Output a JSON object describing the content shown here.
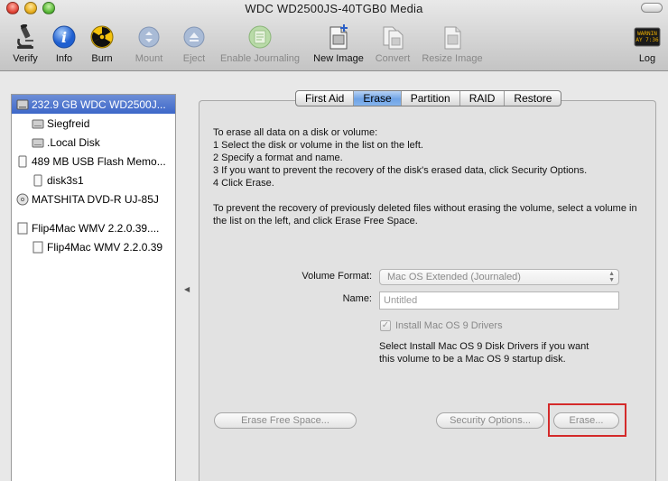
{
  "window": {
    "title": "WDC WD2500JS-40TGB0 Media"
  },
  "toolbar": {
    "items": [
      {
        "label": "Verify",
        "icon": "microscope-icon",
        "enabled": true
      },
      {
        "label": "Info",
        "icon": "info-icon",
        "enabled": true
      },
      {
        "label": "Burn",
        "icon": "radiation-icon",
        "enabled": true
      },
      {
        "label": "Mount",
        "icon": "mount-icon",
        "enabled": false
      },
      {
        "label": "Eject",
        "icon": "eject-icon",
        "enabled": false
      },
      {
        "label": "Enable Journaling",
        "icon": "journaling-icon",
        "enabled": false
      },
      {
        "label": "New Image",
        "icon": "new-image-icon",
        "enabled": true
      },
      {
        "label": "Convert",
        "icon": "convert-icon",
        "enabled": false
      },
      {
        "label": "Resize Image",
        "icon": "resize-image-icon",
        "enabled": false
      },
      {
        "label": "Log",
        "icon": "log-icon",
        "enabled": true
      }
    ],
    "log_icon_text": [
      "WARNIN",
      "AY 7:36"
    ]
  },
  "sidebar": {
    "items": [
      {
        "label": "232.9 GB WDC WD2500J...",
        "level": 0,
        "kind": "hdd",
        "selected": true
      },
      {
        "label": "Siegfreid",
        "level": 1,
        "kind": "volume"
      },
      {
        "label": ".Local Disk",
        "level": 1,
        "kind": "volume"
      },
      {
        "label": "489 MB USB Flash Memo...",
        "level": 0,
        "kind": "usb"
      },
      {
        "label": "disk3s1",
        "level": 1,
        "kind": "usb"
      },
      {
        "label": "MATSHITA DVD-R UJ-85J",
        "level": 0,
        "kind": "dvd"
      },
      {
        "label": "Flip4Mac WMV 2.2.0.39....",
        "level": 0,
        "kind": "image",
        "gap_before": true
      },
      {
        "label": "Flip4Mac WMV 2.2.0.39",
        "level": 1,
        "kind": "image"
      }
    ]
  },
  "tabs": [
    {
      "label": "First Aid",
      "active": false
    },
    {
      "label": "Erase",
      "active": true
    },
    {
      "label": "Partition",
      "active": false
    },
    {
      "label": "RAID",
      "active": false
    },
    {
      "label": "Restore",
      "active": false
    }
  ],
  "erase": {
    "instructions": [
      "To erase all data on a disk or volume:",
      "1 Select the disk or volume in the list on the left.",
      "2 Specify a format and name.",
      "3 If you want to prevent the recovery of the disk's erased data, click Security Options.",
      "4 Click Erase."
    ],
    "free_space_instructions": "To prevent the recovery of previously deleted files without erasing the volume, select a volume in the list on the left, and click Erase Free Space.",
    "volume_format_label": "Volume Format:",
    "volume_format_value": "Mac OS Extended (Journaled)",
    "name_label": "Name:",
    "name_value": "Untitled",
    "os9_checkbox_label": "Install Mac OS 9 Drivers",
    "os9_note": "Select Install Mac OS 9 Disk Drivers if you want this volume to be a Mac OS 9 startup disk.",
    "erase_free_space_button": "Erase Free Space...",
    "security_options_button": "Security Options...",
    "erase_button": "Erase..."
  },
  "colors": {
    "selection": "#3d67c9",
    "active_tab": "#6fa3e6",
    "highlight": "#d42a2a"
  }
}
